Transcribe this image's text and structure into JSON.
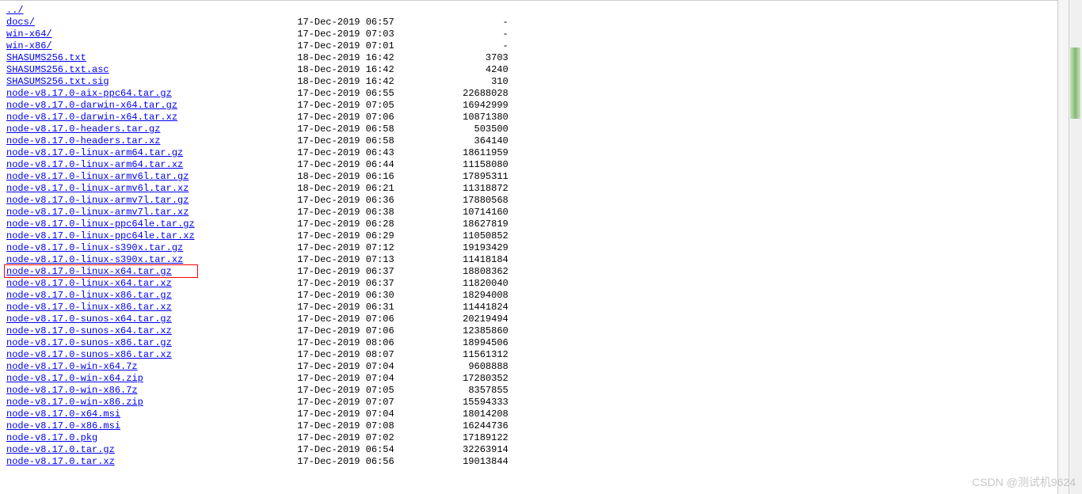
{
  "watermark": "CSDN @测试机9624",
  "parent_link": "../",
  "highlight_index": 19,
  "files": [
    {
      "name": "docs/",
      "date": "17-Dec-2019 06:57",
      "size": "-"
    },
    {
      "name": "win-x64/",
      "date": "17-Dec-2019 07:03",
      "size": "-"
    },
    {
      "name": "win-x86/",
      "date": "17-Dec-2019 07:01",
      "size": "-"
    },
    {
      "name": "SHASUMS256.txt",
      "date": "18-Dec-2019 16:42",
      "size": "3703"
    },
    {
      "name": "SHASUMS256.txt.asc",
      "date": "18-Dec-2019 16:42",
      "size": "4240"
    },
    {
      "name": "SHASUMS256.txt.sig",
      "date": "18-Dec-2019 16:42",
      "size": "310"
    },
    {
      "name": "node-v8.17.0-aix-ppc64.tar.gz",
      "date": "17-Dec-2019 06:55",
      "size": "22688028"
    },
    {
      "name": "node-v8.17.0-darwin-x64.tar.gz",
      "date": "17-Dec-2019 07:05",
      "size": "16942999"
    },
    {
      "name": "node-v8.17.0-darwin-x64.tar.xz",
      "date": "17-Dec-2019 07:06",
      "size": "10871380"
    },
    {
      "name": "node-v8.17.0-headers.tar.gz",
      "date": "17-Dec-2019 06:58",
      "size": "503500"
    },
    {
      "name": "node-v8.17.0-headers.tar.xz",
      "date": "17-Dec-2019 06:58",
      "size": "364140"
    },
    {
      "name": "node-v8.17.0-linux-arm64.tar.gz",
      "date": "17-Dec-2019 06:43",
      "size": "18611959"
    },
    {
      "name": "node-v8.17.0-linux-arm64.tar.xz",
      "date": "17-Dec-2019 06:44",
      "size": "11158080"
    },
    {
      "name": "node-v8.17.0-linux-armv6l.tar.gz",
      "date": "18-Dec-2019 06:16",
      "size": "17895311"
    },
    {
      "name": "node-v8.17.0-linux-armv6l.tar.xz",
      "date": "18-Dec-2019 06:21",
      "size": "11318872"
    },
    {
      "name": "node-v8.17.0-linux-armv7l.tar.gz",
      "date": "17-Dec-2019 06:36",
      "size": "17880568"
    },
    {
      "name": "node-v8.17.0-linux-armv7l.tar.xz",
      "date": "17-Dec-2019 06:38",
      "size": "10714160"
    },
    {
      "name": "node-v8.17.0-linux-ppc64le.tar.gz",
      "date": "17-Dec-2019 06:28",
      "size": "18627819"
    },
    {
      "name": "node-v8.17.0-linux-ppc64le.tar.xz",
      "date": "17-Dec-2019 06:29",
      "size": "11050852"
    },
    {
      "name": "node-v8.17.0-linux-s390x.tar.gz",
      "date": "17-Dec-2019 07:12",
      "size": "19193429"
    },
    {
      "name": "node-v8.17.0-linux-s390x.tar.xz",
      "date": "17-Dec-2019 07:13",
      "size": "11418184"
    },
    {
      "name": "node-v8.17.0-linux-x64.tar.gz",
      "date": "17-Dec-2019 06:37",
      "size": "18808362"
    },
    {
      "name": "node-v8.17.0-linux-x64.tar.xz",
      "date": "17-Dec-2019 06:37",
      "size": "11820040"
    },
    {
      "name": "node-v8.17.0-linux-x86.tar.gz",
      "date": "17-Dec-2019 06:30",
      "size": "18294008"
    },
    {
      "name": "node-v8.17.0-linux-x86.tar.xz",
      "date": "17-Dec-2019 06:31",
      "size": "11441824"
    },
    {
      "name": "node-v8.17.0-sunos-x64.tar.gz",
      "date": "17-Dec-2019 07:06",
      "size": "20219494"
    },
    {
      "name": "node-v8.17.0-sunos-x64.tar.xz",
      "date": "17-Dec-2019 07:06",
      "size": "12385860"
    },
    {
      "name": "node-v8.17.0-sunos-x86.tar.gz",
      "date": "17-Dec-2019 08:06",
      "size": "18994506"
    },
    {
      "name": "node-v8.17.0-sunos-x86.tar.xz",
      "date": "17-Dec-2019 08:07",
      "size": "11561312"
    },
    {
      "name": "node-v8.17.0-win-x64.7z",
      "date": "17-Dec-2019 07:04",
      "size": "9608888"
    },
    {
      "name": "node-v8.17.0-win-x64.zip",
      "date": "17-Dec-2019 07:04",
      "size": "17280352"
    },
    {
      "name": "node-v8.17.0-win-x86.7z",
      "date": "17-Dec-2019 07:05",
      "size": "8357855"
    },
    {
      "name": "node-v8.17.0-win-x86.zip",
      "date": "17-Dec-2019 07:07",
      "size": "15594333"
    },
    {
      "name": "node-v8.17.0-x64.msi",
      "date": "17-Dec-2019 07:04",
      "size": "18014208"
    },
    {
      "name": "node-v8.17.0-x86.msi",
      "date": "17-Dec-2019 07:08",
      "size": "16244736"
    },
    {
      "name": "node-v8.17.0.pkg",
      "date": "17-Dec-2019 07:02",
      "size": "17189122"
    },
    {
      "name": "node-v8.17.0.tar.gz",
      "date": "17-Dec-2019 06:54",
      "size": "32263914"
    },
    {
      "name": "node-v8.17.0.tar.xz",
      "date": "17-Dec-2019 06:56",
      "size": "19013844"
    }
  ]
}
